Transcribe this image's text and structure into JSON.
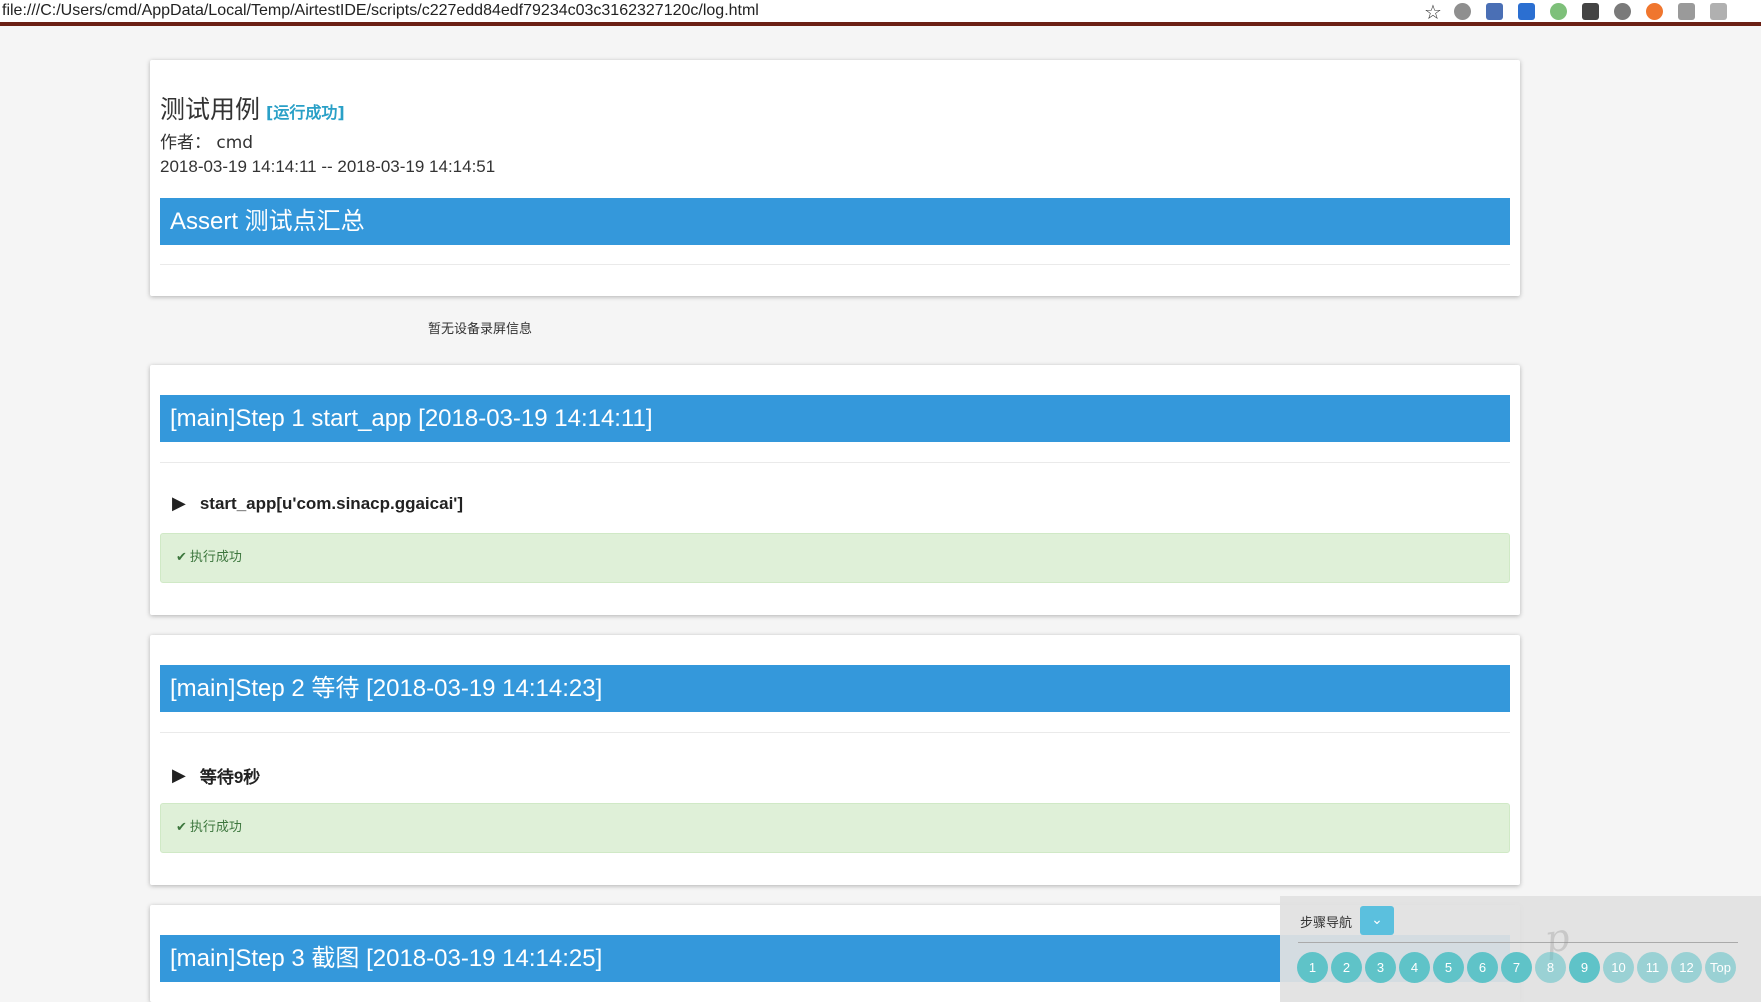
{
  "browser": {
    "address": "file:///C:/Users/cmd/AppData/Local/Temp/AirtestIDE/scripts/c227edd84edf79234c03c3162327120c/log.html",
    "star_icon": "star-icon",
    "extensions": [
      {
        "name": "ext-gray-icon",
        "color": "#8f8f8f"
      },
      {
        "name": "ext-blue-icon",
        "color": "#4a6fb5"
      },
      {
        "name": "ext-word-icon",
        "color": "#2b6fd1"
      },
      {
        "name": "ext-green-icon",
        "color": "#7ec07a"
      },
      {
        "name": "ext-glasses-icon",
        "color": "#444444"
      },
      {
        "name": "ext-cloud-icon",
        "color": "#7a7a7a"
      },
      {
        "name": "ext-orange-icon",
        "color": "#f0762e"
      },
      {
        "name": "ext-page-icon",
        "color": "#9a9a9a"
      },
      {
        "name": "ext-chat-icon",
        "color": "#b0b0b0"
      }
    ]
  },
  "summary": {
    "title": "测试用例",
    "status": "[运行成功]",
    "author": "作者： cmd",
    "time_range": "2018-03-19 14:14:11 -- 2018-03-19 14:14:51",
    "assert_header": "Assert 测试点汇总"
  },
  "no_record_text": "暂无设备录屏信息",
  "steps": [
    {
      "header": "[main]Step 1 start_app [2018-03-19 14:14:11]",
      "title": "start_app[u'com.sinacp.ggaicai']",
      "result": "执行成功"
    },
    {
      "header": "[main]Step 2 等待 [2018-03-19 14:14:23]",
      "title": "等待9秒",
      "result": "执行成功"
    },
    {
      "header": "[main]Step 3 截图 [2018-03-19 14:14:25]"
    }
  ],
  "navigator": {
    "label": "步骤导航",
    "toggle_icon": "chevron-down-icon",
    "items": [
      "1",
      "2",
      "3",
      "4",
      "5",
      "6",
      "7",
      "8",
      "9",
      "10",
      "11",
      "12",
      "Top"
    ]
  },
  "colors": {
    "header_blue": "#3498db",
    "success_bg": "#dff0d8",
    "success_text": "#3c763d",
    "nav_dot": "#5fc3c8"
  }
}
